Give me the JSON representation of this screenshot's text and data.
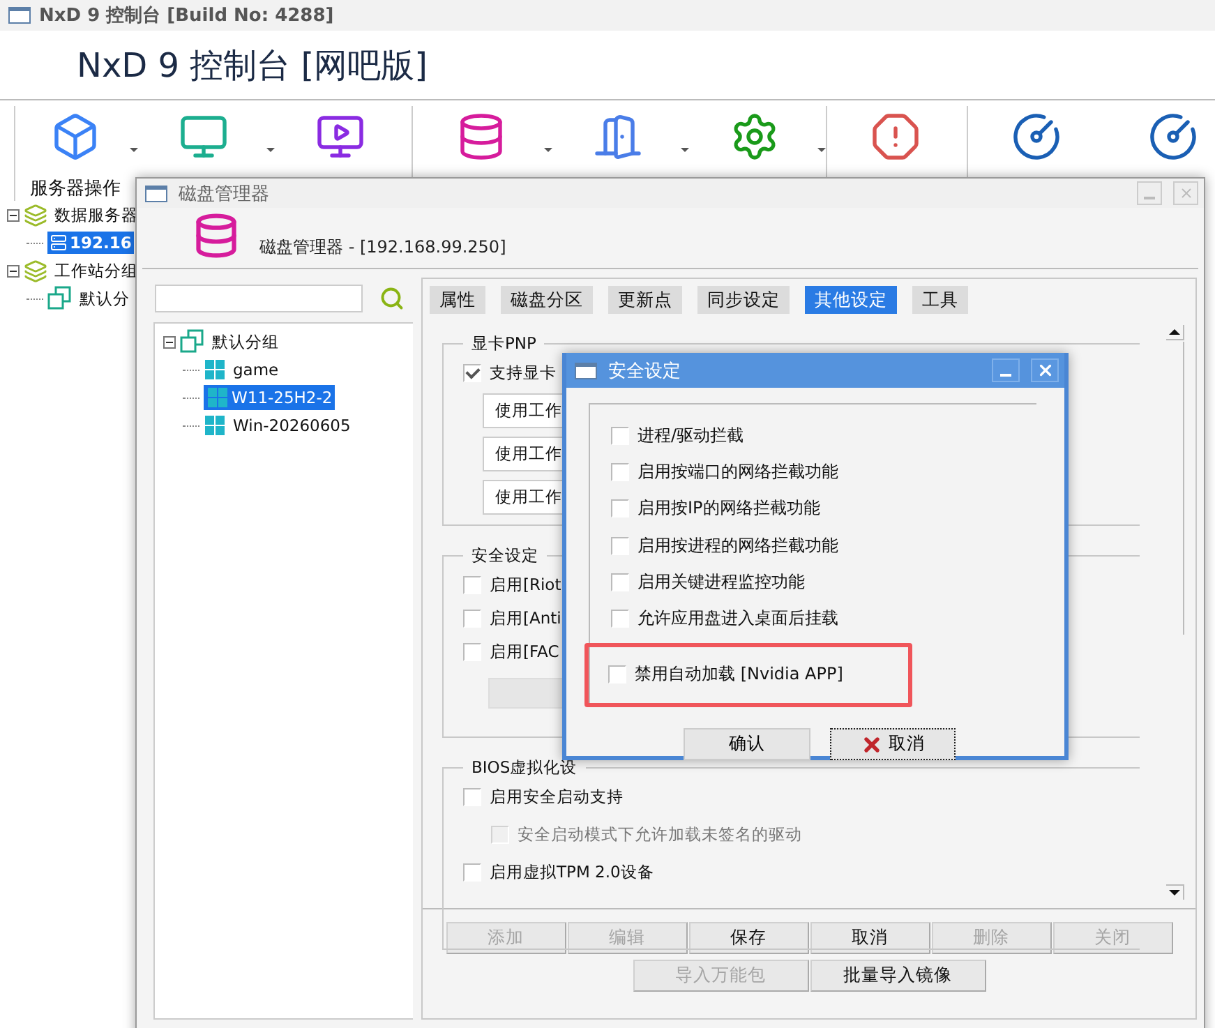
{
  "window": {
    "title": "NxD 9 控制台 [Build No: 4288]"
  },
  "header": {
    "title": "NxD 9 控制台 [网吧版]"
  },
  "toolbar": {
    "groups": [
      [
        {
          "kind": "server",
          "label": "服务器操作",
          "dropdown": true
        },
        {
          "kind": "workstation",
          "dropdown": true
        },
        {
          "kind": "restore",
          "dropdown": false
        }
      ],
      [
        {
          "kind": "disk",
          "dropdown": true
        },
        {
          "kind": "device",
          "dropdown": true
        },
        {
          "kind": "options",
          "dropdown": true
        }
      ],
      [
        {
          "kind": "about",
          "dropdown": false
        }
      ],
      [
        {
          "kind": "gauge",
          "dropdown": false
        },
        {
          "kind": "gauge",
          "dropdown": false
        }
      ]
    ]
  },
  "sidebar": {
    "tree": [
      {
        "label": "数据服务器",
        "kind": "layers",
        "expanded": true,
        "selected": false,
        "children": [
          {
            "label": "192.16",
            "kind": "server",
            "selected": true
          }
        ]
      },
      {
        "label": "工作站分组",
        "kind": "layers",
        "expanded": true,
        "selected": false,
        "children": [
          {
            "label": "默认分",
            "kind": "group",
            "selected": false
          }
        ]
      }
    ]
  },
  "disk_manager": {
    "title": "磁盘管理器",
    "heading": "磁盘管理器 - [192.168.99.250]",
    "tree": [
      {
        "label": "默认分组",
        "kind": "group",
        "expanded": true,
        "selected": false,
        "children": [
          {
            "label": "game",
            "kind": "windows",
            "selected": false
          },
          {
            "label": "W11-25H2-2",
            "kind": "windows",
            "selected": true
          },
          {
            "label": "Win-20260605",
            "kind": "windows",
            "selected": false
          }
        ]
      }
    ],
    "tabs": [
      {
        "label": "属性",
        "selected": false
      },
      {
        "label": "磁盘分区",
        "selected": false
      },
      {
        "label": "更新点",
        "selected": false
      },
      {
        "label": "同步设定",
        "selected": false
      },
      {
        "label": "其他设定",
        "selected": true
      },
      {
        "label": "工具",
        "selected": false
      }
    ],
    "groups": [
      {
        "title": "显卡PNP",
        "items": [
          {
            "kind": "checkbox",
            "label": "支持显卡",
            "checked": true,
            "disabled": false
          },
          {
            "kind": "field",
            "value": "使用工作"
          },
          {
            "kind": "field",
            "value": "使用工作"
          },
          {
            "kind": "field",
            "value": "使用工作"
          }
        ]
      },
      {
        "title": "安全设定",
        "items": [
          {
            "kind": "checkbox",
            "label": "启用[Riot",
            "checked": false,
            "disabled": false
          },
          {
            "kind": "checkbox",
            "label": "启用[Anti",
            "checked": false,
            "disabled": false
          },
          {
            "kind": "checkbox",
            "label": "启用[FAC",
            "checked": false,
            "disabled": false
          },
          {
            "kind": "button"
          }
        ]
      },
      {
        "title": "BIOS虚拟化设",
        "items": [
          {
            "kind": "checkbox",
            "label": "启用安全启动支持",
            "checked": false,
            "disabled": false,
            "children": [
              {
                "kind": "checkbox",
                "label": "安全启动模式下允许加载未签名的驱动",
                "checked": false,
                "disabled": true
              }
            ]
          },
          {
            "kind": "checkbox",
            "label": "启用虚拟TPM 2.0设备",
            "checked": false,
            "disabled": false
          }
        ]
      }
    ],
    "buttons": [
      {
        "label": "添加",
        "disabled": true
      },
      {
        "label": "编辑",
        "disabled": true
      },
      {
        "label": "保存",
        "disabled": false
      },
      {
        "label": "取消",
        "disabled": false
      },
      {
        "label": "删除",
        "disabled": true
      },
      {
        "label": "关闭",
        "disabled": true
      }
    ],
    "buttons_row2": [
      {
        "label": "导入万能包",
        "disabled": true
      },
      {
        "label": "批量导入镜像",
        "disabled": false
      }
    ]
  },
  "dialog": {
    "title": "安全设定",
    "options": [
      {
        "label": "进程/驱动拦截",
        "checked": false,
        "highlighted": false
      },
      {
        "label": "启用按端口的网络拦截功能",
        "checked": false,
        "highlighted": false
      },
      {
        "label": "启用按IP的网络拦截功能",
        "checked": false,
        "highlighted": false
      },
      {
        "label": "启用按进程的网络拦截功能",
        "checked": false,
        "highlighted": false
      },
      {
        "label": "启用关键进程监控功能",
        "checked": false,
        "highlighted": false
      },
      {
        "label": "允许应用盘进入桌面后挂载",
        "checked": false,
        "highlighted": false
      },
      {
        "label": "禁用自动加载 [Nvidia APP]",
        "checked": false,
        "highlighted": true
      }
    ],
    "buttons": [
      {
        "label": "确认",
        "kind": "confirm"
      },
      {
        "label": "取消",
        "kind": "cancel"
      }
    ]
  }
}
